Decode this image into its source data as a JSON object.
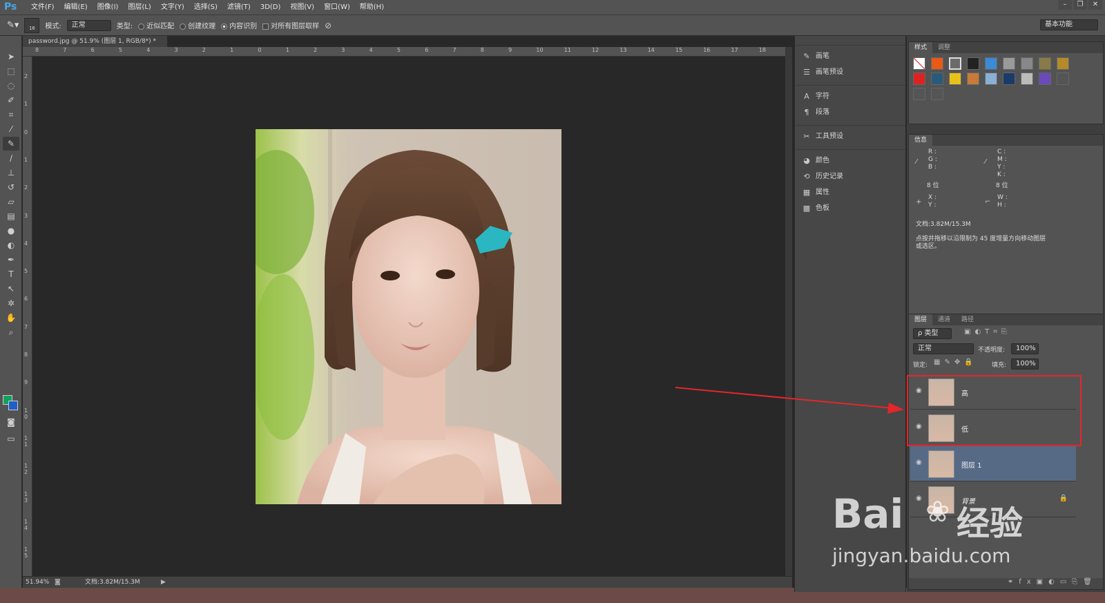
{
  "app": {
    "logo": "Ps"
  },
  "menu": [
    "文件(F)",
    "编辑(E)",
    "图像(I)",
    "图层(L)",
    "文字(Y)",
    "选择(S)",
    "滤镜(T)",
    "3D(D)",
    "视图(V)",
    "窗口(W)",
    "帮助(H)"
  ],
  "window_controls": [
    "–",
    "❐",
    "✕"
  ],
  "options": {
    "brush_size": "16",
    "mode_label": "模式:",
    "mode_value": "正常",
    "type_label": "类型:",
    "radio1": "近似匹配",
    "radio2": "创建纹理",
    "radio3": "内容识别",
    "checkbox": "对所有图层取样",
    "workspace": "基本功能"
  },
  "document": {
    "tab": "password.jpg @ 51.9% (图层 1, RGB/8*) *",
    "zoom": "51.94%",
    "doc_size": "文档:3.82M/15.3M"
  },
  "ruler_h": [
    "8",
    "7",
    "6",
    "5",
    "4",
    "3",
    "2",
    "1",
    "0",
    "1",
    "2",
    "3",
    "4",
    "5",
    "6",
    "7",
    "8",
    "9",
    "10",
    "11",
    "12",
    "13",
    "14",
    "15",
    "16",
    "17",
    "18"
  ],
  "ruler_v": [
    "2",
    "1",
    "0",
    "1",
    "2",
    "3",
    "4",
    "5",
    "6",
    "7",
    "8",
    "9",
    "1 0",
    "1 1",
    "1 2",
    "1 3",
    "1 4",
    "1 5"
  ],
  "dock": {
    "g1": [
      "画笔",
      "画笔预设"
    ],
    "g2": [
      "字符",
      "段落"
    ],
    "g3": [
      "工具预设"
    ],
    "g4": [
      "颜色",
      "历史记录",
      "属性",
      "色板"
    ]
  },
  "styles_panel": {
    "tabs": [
      "样式",
      "调整"
    ]
  },
  "info_panel": {
    "tab": "信息",
    "rgb": "R :\nG :\nB :",
    "cmyk": "C :\nM :\nY :\nK :",
    "bits": "8 位",
    "xy": "X :\nY :",
    "wh": "W :\nH :",
    "doc": "文档:3.82M/15.3M",
    "hint": "点按并拖移以沿限制为 45 度增量方向移动图层或选区。"
  },
  "layers_panel": {
    "tabs": [
      "图层",
      "通道",
      "路径"
    ],
    "filter": "ρ 类型",
    "blend": "正常",
    "opacity_label": "不透明度:",
    "opacity": "100%",
    "lock_label": "锁定:",
    "fill_label": "填充:",
    "fill": "100%",
    "layers": [
      "高",
      "低",
      "图层 1",
      "背景"
    ]
  },
  "watermark": {
    "brand": "Bai",
    "cn": "经验",
    "url": "jingyan.baidu.com"
  },
  "colors": {
    "accent": "#e5262b",
    "fg": "#13a05c",
    "bg": "#1f5fc8"
  }
}
